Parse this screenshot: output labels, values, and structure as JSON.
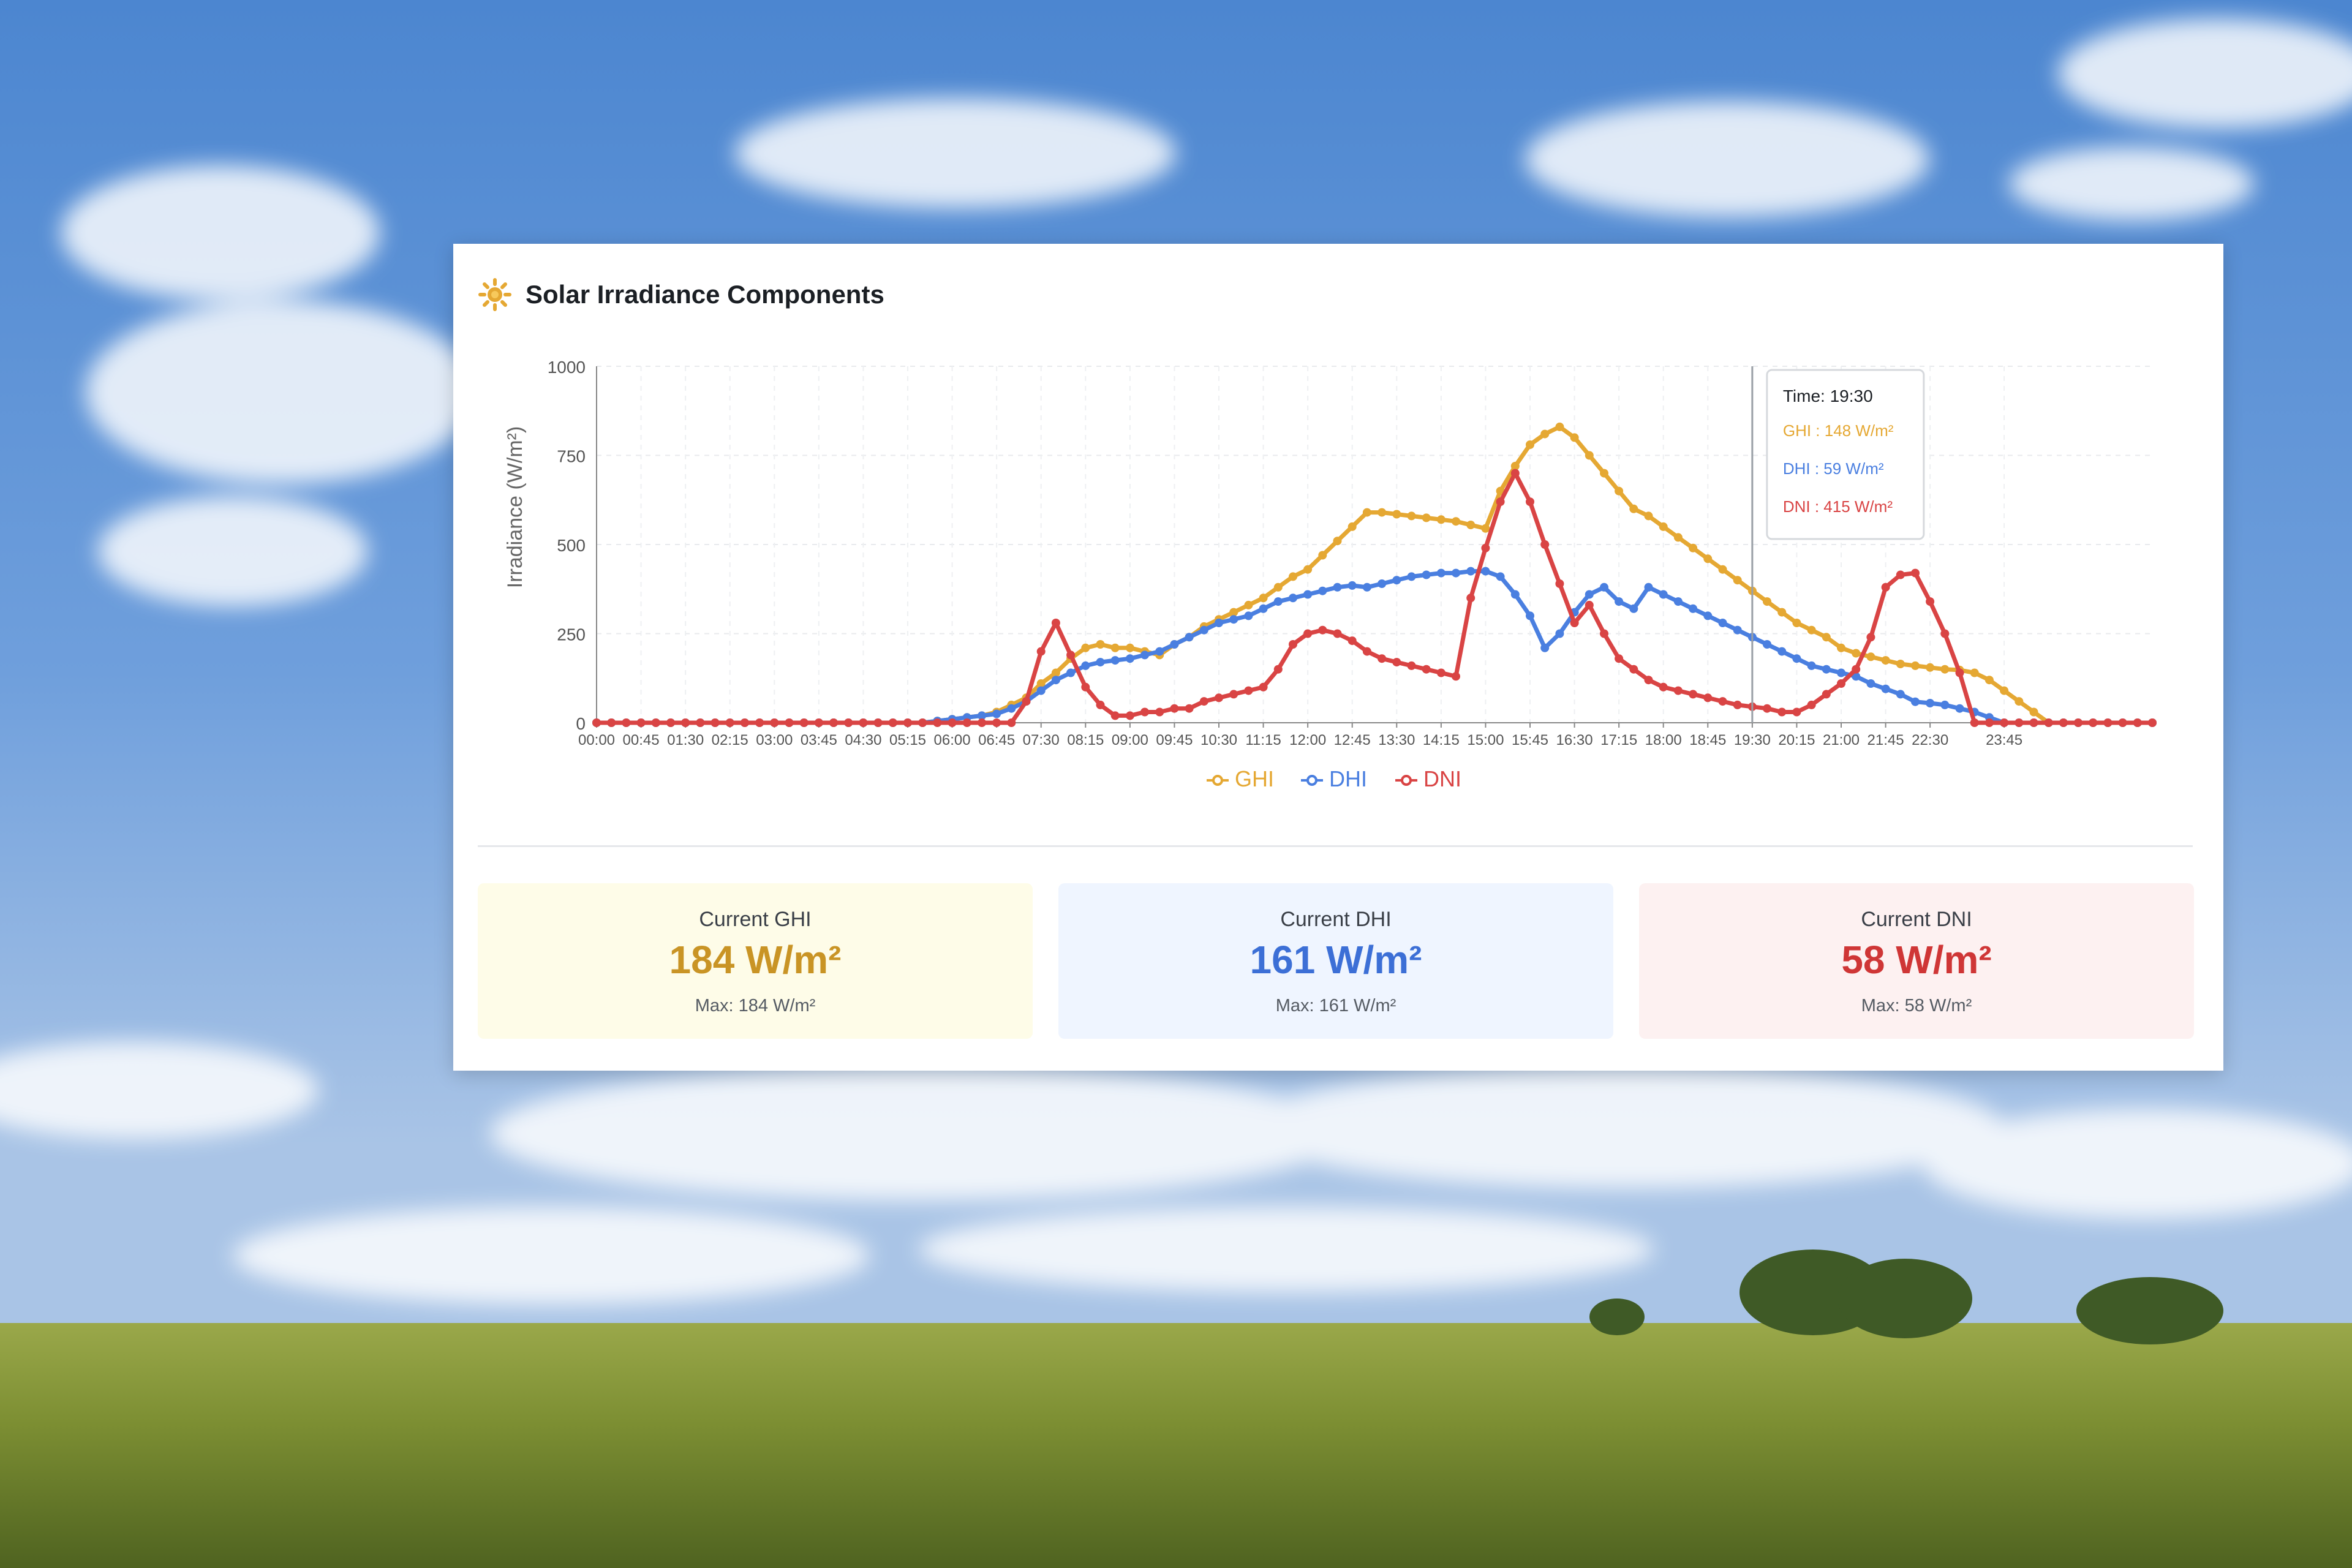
{
  "card": {
    "title": "Solar Irradiance Components",
    "icon": "sun-icon"
  },
  "colors": {
    "ghi": "#e5a833",
    "dhi": "#4a7fe0",
    "dni": "#d94444"
  },
  "tooltip": {
    "time_label": "Time: 19:30",
    "ghi_text": "GHI : 148 W/m²",
    "dhi_text": "DHI : 59 W/m²",
    "dni_text": "DNI : 415 W/m²"
  },
  "stats": [
    {
      "label": "Current GHI",
      "value": "184 W/m²",
      "max": "Max: 184 W/m²"
    },
    {
      "label": "Current DHI",
      "value": "161 W/m²",
      "max": "Max: 161 W/m²"
    },
    {
      "label": "Current DNI",
      "value": "58 W/m²",
      "max": "Max: 58 W/m²"
    }
  ],
  "chart_data": {
    "type": "line",
    "ylabel": "Irradiance (W/m²)",
    "xlabel": "",
    "ylim": [
      0,
      1000
    ],
    "yticks": [
      0,
      250,
      500,
      750,
      1000
    ],
    "grid": true,
    "legend_position": "bottom-center",
    "x_tick_labels": [
      "00:00",
      "00:45",
      "01:30",
      "02:15",
      "03:00",
      "03:45",
      "04:30",
      "05:15",
      "06:00",
      "06:45",
      "07:30",
      "08:15",
      "09:00",
      "09:45",
      "10:30",
      "11:15",
      "12:00",
      "12:45",
      "13:30",
      "14:15",
      "15:00",
      "15:45",
      "16:30",
      "17:15",
      "18:00",
      "18:45",
      "19:30",
      "20:15",
      "21:00",
      "21:45",
      "22:30",
      "23:45"
    ],
    "x_start": "00:00",
    "x_step_minutes": 15,
    "hover_time": "19:30",
    "series": [
      {
        "name": "GHI",
        "values": [
          0,
          0,
          0,
          0,
          0,
          0,
          0,
          0,
          0,
          0,
          0,
          0,
          0,
          0,
          0,
          0,
          0,
          0,
          0,
          0,
          0,
          0,
          0,
          5,
          10,
          15,
          20,
          30,
          50,
          70,
          110,
          140,
          180,
          210,
          220,
          210,
          210,
          200,
          190,
          220,
          240,
          270,
          290,
          310,
          330,
          350,
          380,
          410,
          430,
          470,
          510,
          550,
          590,
          590,
          585,
          580,
          575,
          570,
          565,
          555,
          545,
          650,
          720,
          780,
          810,
          830,
          800,
          750,
          700,
          650,
          600,
          580,
          550,
          520,
          490,
          460,
          430,
          400,
          370,
          340,
          310,
          280,
          260,
          240,
          210,
          195,
          185,
          175,
          165,
          160,
          155,
          150,
          148,
          140,
          120,
          90,
          60,
          30,
          0,
          0,
          0,
          0,
          0,
          0,
          0,
          0
        ]
      },
      {
        "name": "DHI",
        "values": [
          0,
          0,
          0,
          0,
          0,
          0,
          0,
          0,
          0,
          0,
          0,
          0,
          0,
          0,
          0,
          0,
          0,
          0,
          0,
          0,
          0,
          0,
          0,
          5,
          10,
          15,
          20,
          25,
          40,
          60,
          90,
          120,
          140,
          160,
          170,
          175,
          180,
          190,
          200,
          220,
          240,
          260,
          280,
          290,
          300,
          320,
          340,
          350,
          360,
          370,
          380,
          385,
          380,
          390,
          400,
          410,
          415,
          420,
          420,
          425,
          425,
          410,
          360,
          300,
          210,
          250,
          310,
          360,
          380,
          340,
          320,
          380,
          360,
          340,
          320,
          300,
          280,
          260,
          240,
          220,
          200,
          180,
          160,
          150,
          140,
          130,
          110,
          95,
          80,
          59,
          55,
          50,
          40,
          30,
          15,
          0,
          0,
          0,
          0,
          0,
          0,
          0,
          0,
          0,
          0,
          0
        ]
      },
      {
        "name": "DNI",
        "values": [
          0,
          0,
          0,
          0,
          0,
          0,
          0,
          0,
          0,
          0,
          0,
          0,
          0,
          0,
          0,
          0,
          0,
          0,
          0,
          0,
          0,
          0,
          0,
          0,
          0,
          0,
          0,
          0,
          0,
          60,
          200,
          280,
          190,
          100,
          50,
          20,
          20,
          30,
          30,
          40,
          40,
          60,
          70,
          80,
          90,
          100,
          150,
          220,
          250,
          260,
          250,
          230,
          200,
          180,
          170,
          160,
          150,
          140,
          130,
          350,
          490,
          620,
          700,
          620,
          500,
          390,
          280,
          330,
          250,
          180,
          150,
          120,
          100,
          90,
          80,
          70,
          60,
          50,
          45,
          40,
          30,
          30,
          50,
          80,
          110,
          150,
          240,
          380,
          415,
          420,
          340,
          250,
          140,
          0,
          0,
          0,
          0,
          0,
          0,
          0,
          0,
          0,
          0,
          0,
          0,
          0
        ]
      }
    ]
  }
}
